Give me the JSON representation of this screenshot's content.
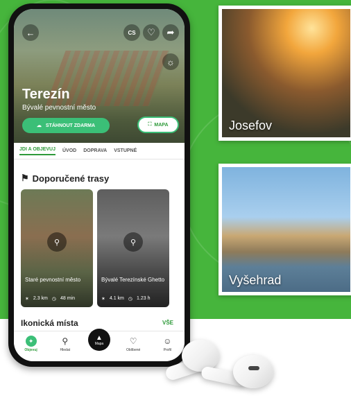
{
  "side_photos": [
    {
      "label": "Josefov"
    },
    {
      "label": "Vyšehrad"
    }
  ],
  "app": {
    "hero": {
      "lang": "CS",
      "title": "Terezín",
      "subtitle": "Bývalé pevnostní město",
      "download_label": "STÁHNOUT ZDARMA",
      "map_label": "MAPA"
    },
    "tabs": [
      {
        "label": "JDI A OBJEVUJ",
        "active": true
      },
      {
        "label": "ÚVOD"
      },
      {
        "label": "DOPRAVA"
      },
      {
        "label": "VSTUPNÉ"
      }
    ],
    "routes_title": "Doporučené trasy",
    "routes": [
      {
        "name": "Staré pevnostní město",
        "distance": "2.3 km",
        "duration": "48 min"
      },
      {
        "name": "Bývalé Terezínské Ghetto",
        "distance": "4.1 km",
        "duration": "1.23 h"
      }
    ],
    "iconic_title": "Ikonická místa",
    "iconic_all": "VŠE",
    "nav": [
      {
        "label": "Objevuj",
        "icon": "compass-icon",
        "active": true
      },
      {
        "label": "Hledat",
        "icon": "search-icon"
      },
      {
        "label": "Mapa",
        "icon": "map-pin-icon"
      },
      {
        "label": "Oblíbené",
        "icon": "heart-icon"
      },
      {
        "label": "Profil",
        "icon": "user-icon"
      }
    ]
  },
  "colors": {
    "background": "#46b53c",
    "accent": "#3bbf77",
    "accent_text": "#2e9a3a"
  }
}
